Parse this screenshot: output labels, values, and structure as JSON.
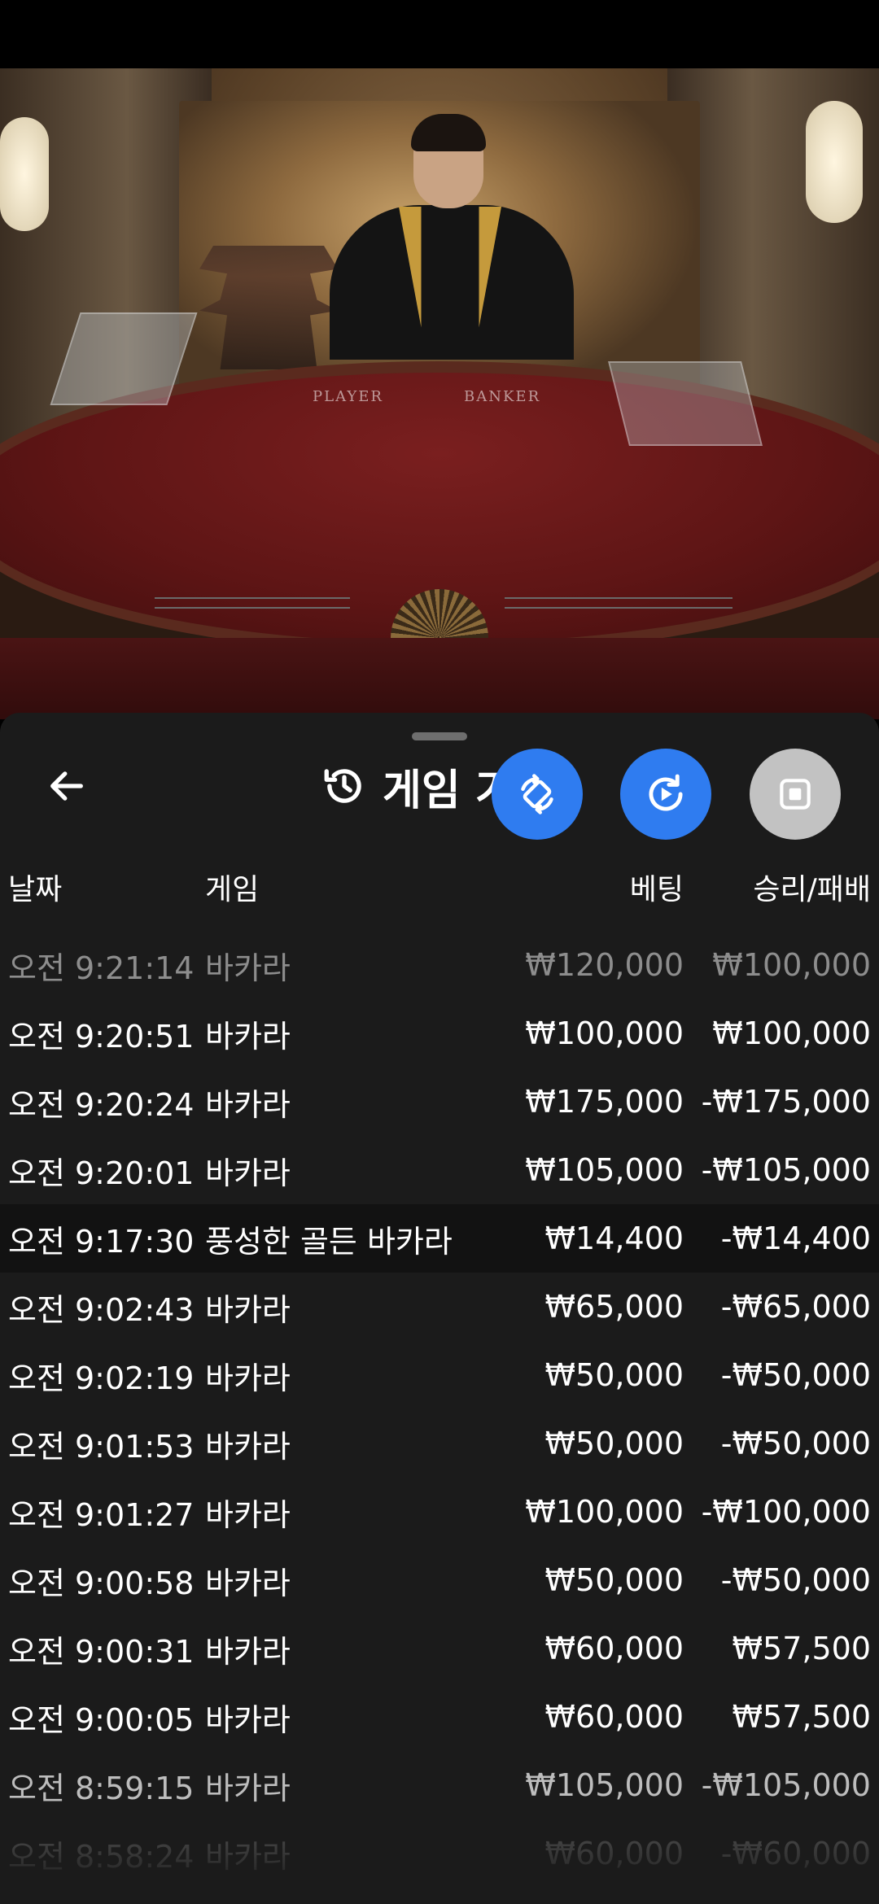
{
  "sheet": {
    "title": "게임 기록",
    "columns": {
      "date": "날짜",
      "game": "게임",
      "bet": "베팅",
      "result": "승리/패배"
    },
    "rows": [
      {
        "time": "오전 9:21:14",
        "game": "바카라",
        "bet": "₩120,000",
        "result": "₩100,000"
      },
      {
        "time": "오전 9:20:51",
        "game": "바카라",
        "bet": "₩100,000",
        "result": "₩100,000"
      },
      {
        "time": "오전 9:20:24",
        "game": "바카라",
        "bet": "₩175,000",
        "result": "-₩175,000"
      },
      {
        "time": "오전 9:20:01",
        "game": "바카라",
        "bet": "₩105,000",
        "result": "-₩105,000"
      },
      {
        "time": "오전 9:17:30",
        "game": "풍성한 골든 바카라",
        "bet": "₩14,400",
        "result": "-₩14,400"
      },
      {
        "time": "오전 9:02:43",
        "game": "바카라",
        "bet": "₩65,000",
        "result": "-₩65,000"
      },
      {
        "time": "오전 9:02:19",
        "game": "바카라",
        "bet": "₩50,000",
        "result": "-₩50,000"
      },
      {
        "time": "오전 9:01:53",
        "game": "바카라",
        "bet": "₩50,000",
        "result": "-₩50,000"
      },
      {
        "time": "오전 9:01:27",
        "game": "바카라",
        "bet": "₩100,000",
        "result": "-₩100,000"
      },
      {
        "time": "오전 9:00:58",
        "game": "바카라",
        "bet": "₩50,000",
        "result": "-₩50,000"
      },
      {
        "time": "오전 9:00:31",
        "game": "바카라",
        "bet": "₩60,000",
        "result": "₩57,500"
      },
      {
        "time": "오전 9:00:05",
        "game": "바카라",
        "bet": "₩60,000",
        "result": "₩57,500"
      },
      {
        "time": "오전 8:59:15",
        "game": "바카라",
        "bet": "₩105,000",
        "result": "-₩105,000"
      },
      {
        "time": "오전 8:58:24",
        "game": "바카라",
        "bet": "₩60,000",
        "result": "-₩60,000"
      }
    ]
  },
  "video": {
    "table_labels": {
      "player": "PLAYER",
      "banker": "BANKER"
    }
  },
  "icons": {
    "back": "arrow-left-icon",
    "history": "history-icon",
    "rotate": "rotate-screen-icon",
    "replay": "replay-icon",
    "stop": "stop-icon"
  },
  "colors": {
    "sheet_bg": "#1b1b1b",
    "accent_blue": "#2f7cf0",
    "stop_grey": "#c2c2c2"
  }
}
